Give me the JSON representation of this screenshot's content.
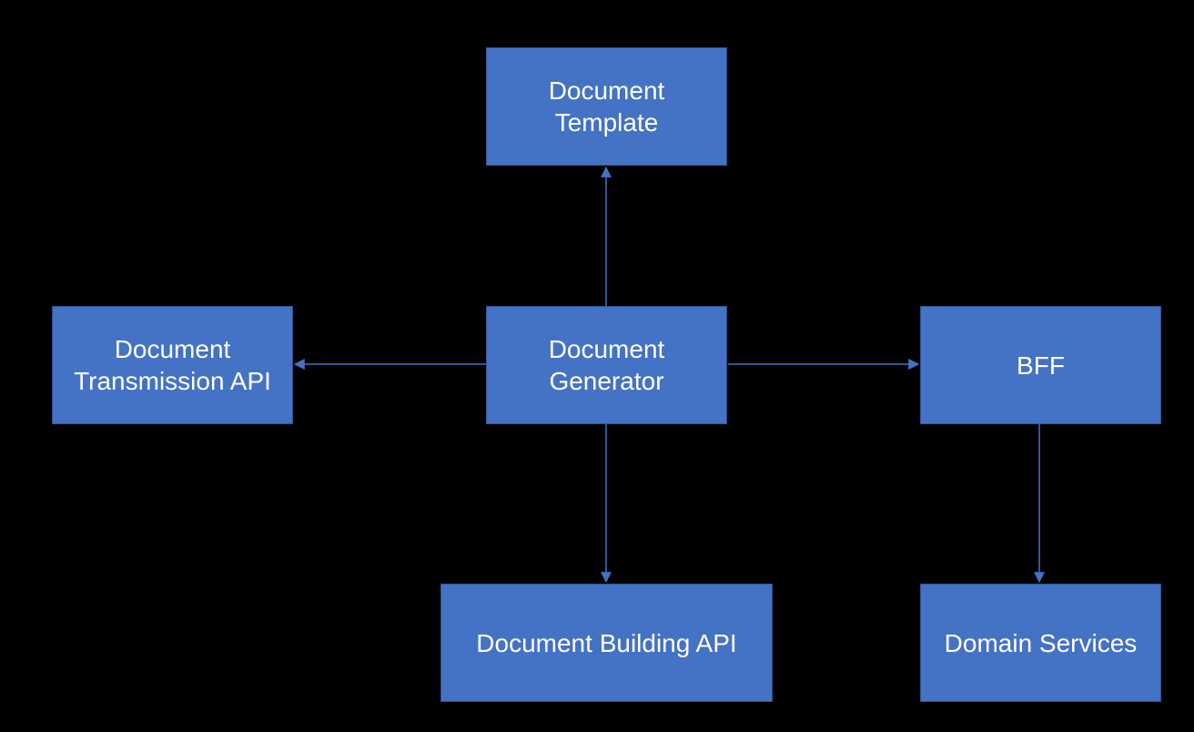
{
  "diagram": {
    "nodes": {
      "document_template": {
        "label": "Document\nTemplate"
      },
      "document_transmission_api": {
        "label": "Document Transmission API"
      },
      "document_generator": {
        "label": "Document Generator"
      },
      "bff": {
        "label": "BFF"
      },
      "document_building_api": {
        "label": "Document Building API"
      },
      "domain_services": {
        "label": "Domain Services"
      }
    },
    "colors": {
      "box_fill": "#4472C4",
      "box_border": "#2F528F",
      "connector": "#4472C4",
      "background": "#000000"
    },
    "edges": [
      {
        "from": "document_generator",
        "to": "document_template",
        "direction": "up"
      },
      {
        "from": "document_generator",
        "to": "document_transmission_api",
        "direction": "left"
      },
      {
        "from": "document_generator",
        "to": "bff",
        "direction": "right"
      },
      {
        "from": "document_generator",
        "to": "document_building_api",
        "direction": "down"
      },
      {
        "from": "bff",
        "to": "domain_services",
        "direction": "down"
      }
    ]
  }
}
